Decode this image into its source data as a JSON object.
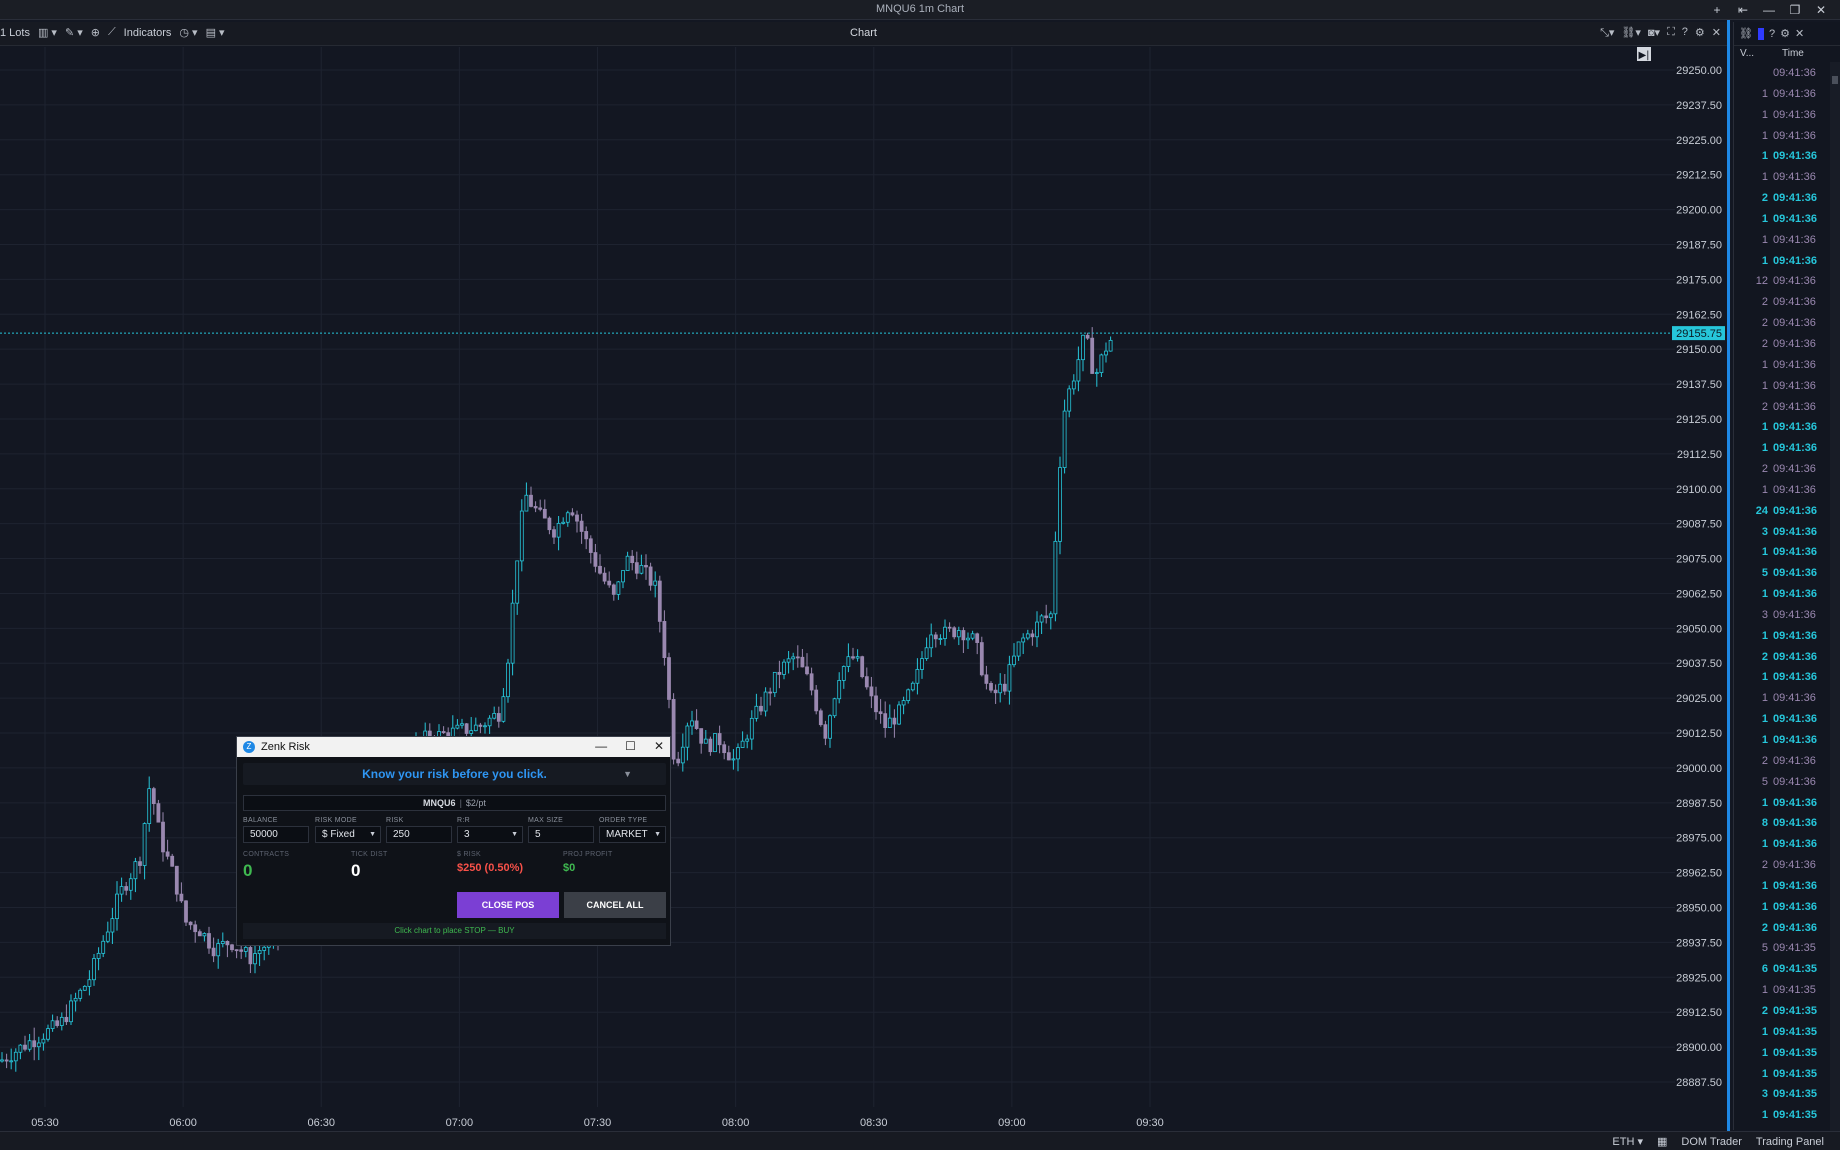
{
  "window": {
    "title": "MNQU6 1m Chart",
    "buttons": [
      "+",
      "⇤",
      "—",
      "❐",
      "✕"
    ]
  },
  "toolbar": {
    "lots": "1 Lots",
    "indicators_label": "Indicators",
    "center_title": "Chart"
  },
  "chart": {
    "price_axis_labels": [
      "29250.00",
      "29237.50",
      "29225.00",
      "29212.50",
      "29200.00",
      "29187.50",
      "29175.00",
      "29162.50",
      "29150.00",
      "29137.50",
      "29125.00",
      "29112.50",
      "29100.00",
      "29087.50",
      "29075.00",
      "29062.50",
      "29050.00",
      "29037.50",
      "29025.00",
      "29012.50",
      "29000.00",
      "28987.50",
      "28975.00",
      "28962.50",
      "28950.00",
      "28937.50",
      "28925.00",
      "28912.50",
      "28900.00",
      "28887.50"
    ],
    "time_axis_labels": [
      "05:30",
      "06:00",
      "06:30",
      "07:00",
      "07:30",
      "08:00",
      "08:30",
      "09:00",
      "09:30"
    ],
    "current_price": "29155.75",
    "colors": {
      "up": "#26c6da",
      "down": "#9a88b0",
      "background": "#131722",
      "grid": "#1e2330",
      "price_line": "#26c6da"
    }
  },
  "chart_data": {
    "type": "candlestick",
    "ylim": [
      28880,
      29255
    ],
    "current_price": 29155.75,
    "x_ticks": [
      "05:30",
      "06:00",
      "06:30",
      "07:00",
      "07:30",
      "08:00",
      "08:30",
      "09:00",
      "09:30"
    ],
    "y_ticks": [
      29250.0,
      29237.5,
      29225.0,
      29212.5,
      29200.0,
      29187.5,
      29175.0,
      29162.5,
      29150.0,
      29137.5,
      29125.0,
      29112.5,
      29100.0,
      29087.5,
      29075.0,
      29062.5,
      29050.0,
      29037.5,
      29025.0,
      29012.5,
      29000.0,
      28987.5,
      28975.0,
      28962.5,
      28950.0,
      28937.5,
      28925.0,
      28912.5,
      28900.0,
      28887.5
    ],
    "close_path_anchors": [
      [
        0,
        28895
      ],
      [
        30,
        28902
      ],
      [
        60,
        28908
      ],
      [
        90,
        28925
      ],
      [
        120,
        28955
      ],
      [
        140,
        28968
      ],
      [
        150,
        28995
      ],
      [
        160,
        28975
      ],
      [
        175,
        28960
      ],
      [
        185,
        28945
      ],
      [
        200,
        28942
      ],
      [
        215,
        28935
      ],
      [
        230,
        28938
      ],
      [
        250,
        28932
      ],
      [
        270,
        28938
      ],
      [
        300,
        28945
      ],
      [
        330,
        28950
      ],
      [
        360,
        28960
      ],
      [
        380,
        28985
      ],
      [
        420,
        29010
      ],
      [
        480,
        29015
      ],
      [
        500,
        29020
      ],
      [
        510,
        29045
      ],
      [
        515,
        29070
      ],
      [
        525,
        29098
      ],
      [
        540,
        29090
      ],
      [
        555,
        29085
      ],
      [
        570,
        29095
      ],
      [
        585,
        29082
      ],
      [
        600,
        29070
      ],
      [
        615,
        29060
      ],
      [
        625,
        29075
      ],
      [
        640,
        29072
      ],
      [
        655,
        29065
      ],
      [
        665,
        29040
      ],
      [
        675,
        29000
      ],
      [
        690,
        29020
      ],
      [
        705,
        29008
      ],
      [
        720,
        29010
      ],
      [
        735,
        29002
      ],
      [
        750,
        29015
      ],
      [
        765,
        29025
      ],
      [
        780,
        29035
      ],
      [
        795,
        29040
      ],
      [
        810,
        29030
      ],
      [
        825,
        29012
      ],
      [
        840,
        29035
      ],
      [
        855,
        29040
      ],
      [
        870,
        29025
      ],
      [
        885,
        29015
      ],
      [
        900,
        29020
      ],
      [
        915,
        29030
      ],
      [
        930,
        29050
      ],
      [
        945,
        29048
      ],
      [
        960,
        29050
      ],
      [
        975,
        29045
      ],
      [
        990,
        29025
      ],
      [
        1005,
        29030
      ],
      [
        1020,
        29045
      ],
      [
        1035,
        29050
      ],
      [
        1045,
        29055
      ],
      [
        1050,
        29050
      ],
      [
        1055,
        29080
      ],
      [
        1060,
        29110
      ],
      [
        1065,
        29130
      ],
      [
        1075,
        29142
      ],
      [
        1085,
        29155
      ],
      [
        1095,
        29140
      ],
      [
        1105,
        29150
      ],
      [
        1115,
        29155.75
      ]
    ]
  },
  "right_panel": {
    "headers": {
      "volume": "V...",
      "time": "Time"
    },
    "rows": [
      {
        "v": "",
        "t": "09:41:36",
        "side": "sell"
      },
      {
        "v": "1",
        "t": "09:41:36",
        "side": "sell"
      },
      {
        "v": "1",
        "t": "09:41:36",
        "side": "sell"
      },
      {
        "v": "1",
        "t": "09:41:36",
        "side": "sell"
      },
      {
        "v": "1",
        "t": "09:41:36",
        "side": "buy"
      },
      {
        "v": "1",
        "t": "09:41:36",
        "side": "sell"
      },
      {
        "v": "2",
        "t": "09:41:36",
        "side": "buy"
      },
      {
        "v": "1",
        "t": "09:41:36",
        "side": "buy"
      },
      {
        "v": "1",
        "t": "09:41:36",
        "side": "sell"
      },
      {
        "v": "1",
        "t": "09:41:36",
        "side": "buy"
      },
      {
        "v": "12",
        "t": "09:41:36",
        "side": "sell"
      },
      {
        "v": "2",
        "t": "09:41:36",
        "side": "sell"
      },
      {
        "v": "2",
        "t": "09:41:36",
        "side": "sell"
      },
      {
        "v": "2",
        "t": "09:41:36",
        "side": "sell"
      },
      {
        "v": "1",
        "t": "09:41:36",
        "side": "sell"
      },
      {
        "v": "1",
        "t": "09:41:36",
        "side": "sell"
      },
      {
        "v": "2",
        "t": "09:41:36",
        "side": "sell"
      },
      {
        "v": "1",
        "t": "09:41:36",
        "side": "buy"
      },
      {
        "v": "1",
        "t": "09:41:36",
        "side": "buy"
      },
      {
        "v": "2",
        "t": "09:41:36",
        "side": "sell"
      },
      {
        "v": "1",
        "t": "09:41:36",
        "side": "sell"
      },
      {
        "v": "24",
        "t": "09:41:36",
        "side": "buy"
      },
      {
        "v": "3",
        "t": "09:41:36",
        "side": "buy"
      },
      {
        "v": "1",
        "t": "09:41:36",
        "side": "buy"
      },
      {
        "v": "5",
        "t": "09:41:36",
        "side": "buy"
      },
      {
        "v": "1",
        "t": "09:41:36",
        "side": "buy"
      },
      {
        "v": "3",
        "t": "09:41:36",
        "side": "sell"
      },
      {
        "v": "1",
        "t": "09:41:36",
        "side": "buy"
      },
      {
        "v": "2",
        "t": "09:41:36",
        "side": "buy"
      },
      {
        "v": "1",
        "t": "09:41:36",
        "side": "buy"
      },
      {
        "v": "1",
        "t": "09:41:36",
        "side": "sell"
      },
      {
        "v": "1",
        "t": "09:41:36",
        "side": "buy"
      },
      {
        "v": "1",
        "t": "09:41:36",
        "side": "buy"
      },
      {
        "v": "2",
        "t": "09:41:36",
        "side": "sell"
      },
      {
        "v": "5",
        "t": "09:41:36",
        "side": "sell"
      },
      {
        "v": "1",
        "t": "09:41:36",
        "side": "buy"
      },
      {
        "v": "8",
        "t": "09:41:36",
        "side": "buy"
      },
      {
        "v": "1",
        "t": "09:41:36",
        "side": "buy"
      },
      {
        "v": "2",
        "t": "09:41:36",
        "side": "sell"
      },
      {
        "v": "1",
        "t": "09:41:36",
        "side": "buy"
      },
      {
        "v": "1",
        "t": "09:41:36",
        "side": "buy"
      },
      {
        "v": "2",
        "t": "09:41:36",
        "side": "buy"
      },
      {
        "v": "5",
        "t": "09:41:35",
        "side": "sell"
      },
      {
        "v": "6",
        "t": "09:41:35",
        "side": "buy"
      },
      {
        "v": "1",
        "t": "09:41:35",
        "side": "sell"
      },
      {
        "v": "2",
        "t": "09:41:35",
        "side": "buy"
      },
      {
        "v": "1",
        "t": "09:41:35",
        "side": "buy"
      },
      {
        "v": "1",
        "t": "09:41:35",
        "side": "buy"
      },
      {
        "v": "1",
        "t": "09:41:35",
        "side": "buy"
      },
      {
        "v": "3",
        "t": "09:41:35",
        "side": "buy"
      },
      {
        "v": "1",
        "t": "09:41:35",
        "side": "buy"
      }
    ]
  },
  "statusbar": {
    "session": "ETH",
    "dom_trader": "DOM Trader",
    "trading_panel": "Trading Panel"
  },
  "dialog": {
    "title": "Zenk Risk",
    "banner": "Know your risk before you click.",
    "symbol": "MNQU6",
    "separator": "|",
    "point_value": "$2/pt",
    "fields": {
      "balance": {
        "label": "BALANCE",
        "value": "50000"
      },
      "risk_mode": {
        "label": "RISK MODE",
        "value": "$ Fixed"
      },
      "risk": {
        "label": "RISK",
        "value": "250"
      },
      "rr": {
        "label": "R:R",
        "value": "3"
      },
      "max_size": {
        "label": "MAX SIZE",
        "value": "5"
      },
      "order_type": {
        "label": "ORDER TYPE",
        "value": "MARKET"
      }
    },
    "stats": {
      "contracts": {
        "label": "CONTRACTS",
        "value": "0"
      },
      "tick_dist": {
        "label": "TICK DIST",
        "value": "0"
      },
      "dollar_risk": {
        "label": "$ RISK",
        "value": "$250 (0.50%)"
      },
      "proj_profit": {
        "label": "PROJ PROFIT",
        "value": "$0"
      }
    },
    "close_pos": "CLOSE POS",
    "cancel_all": "CANCEL ALL",
    "hint": "Click chart to place STOP — BUY",
    "colors": {
      "accent_blue": "#2f96f3",
      "green": "#3fb950",
      "red": "#f85149",
      "purple": "#7b3fd4"
    }
  }
}
